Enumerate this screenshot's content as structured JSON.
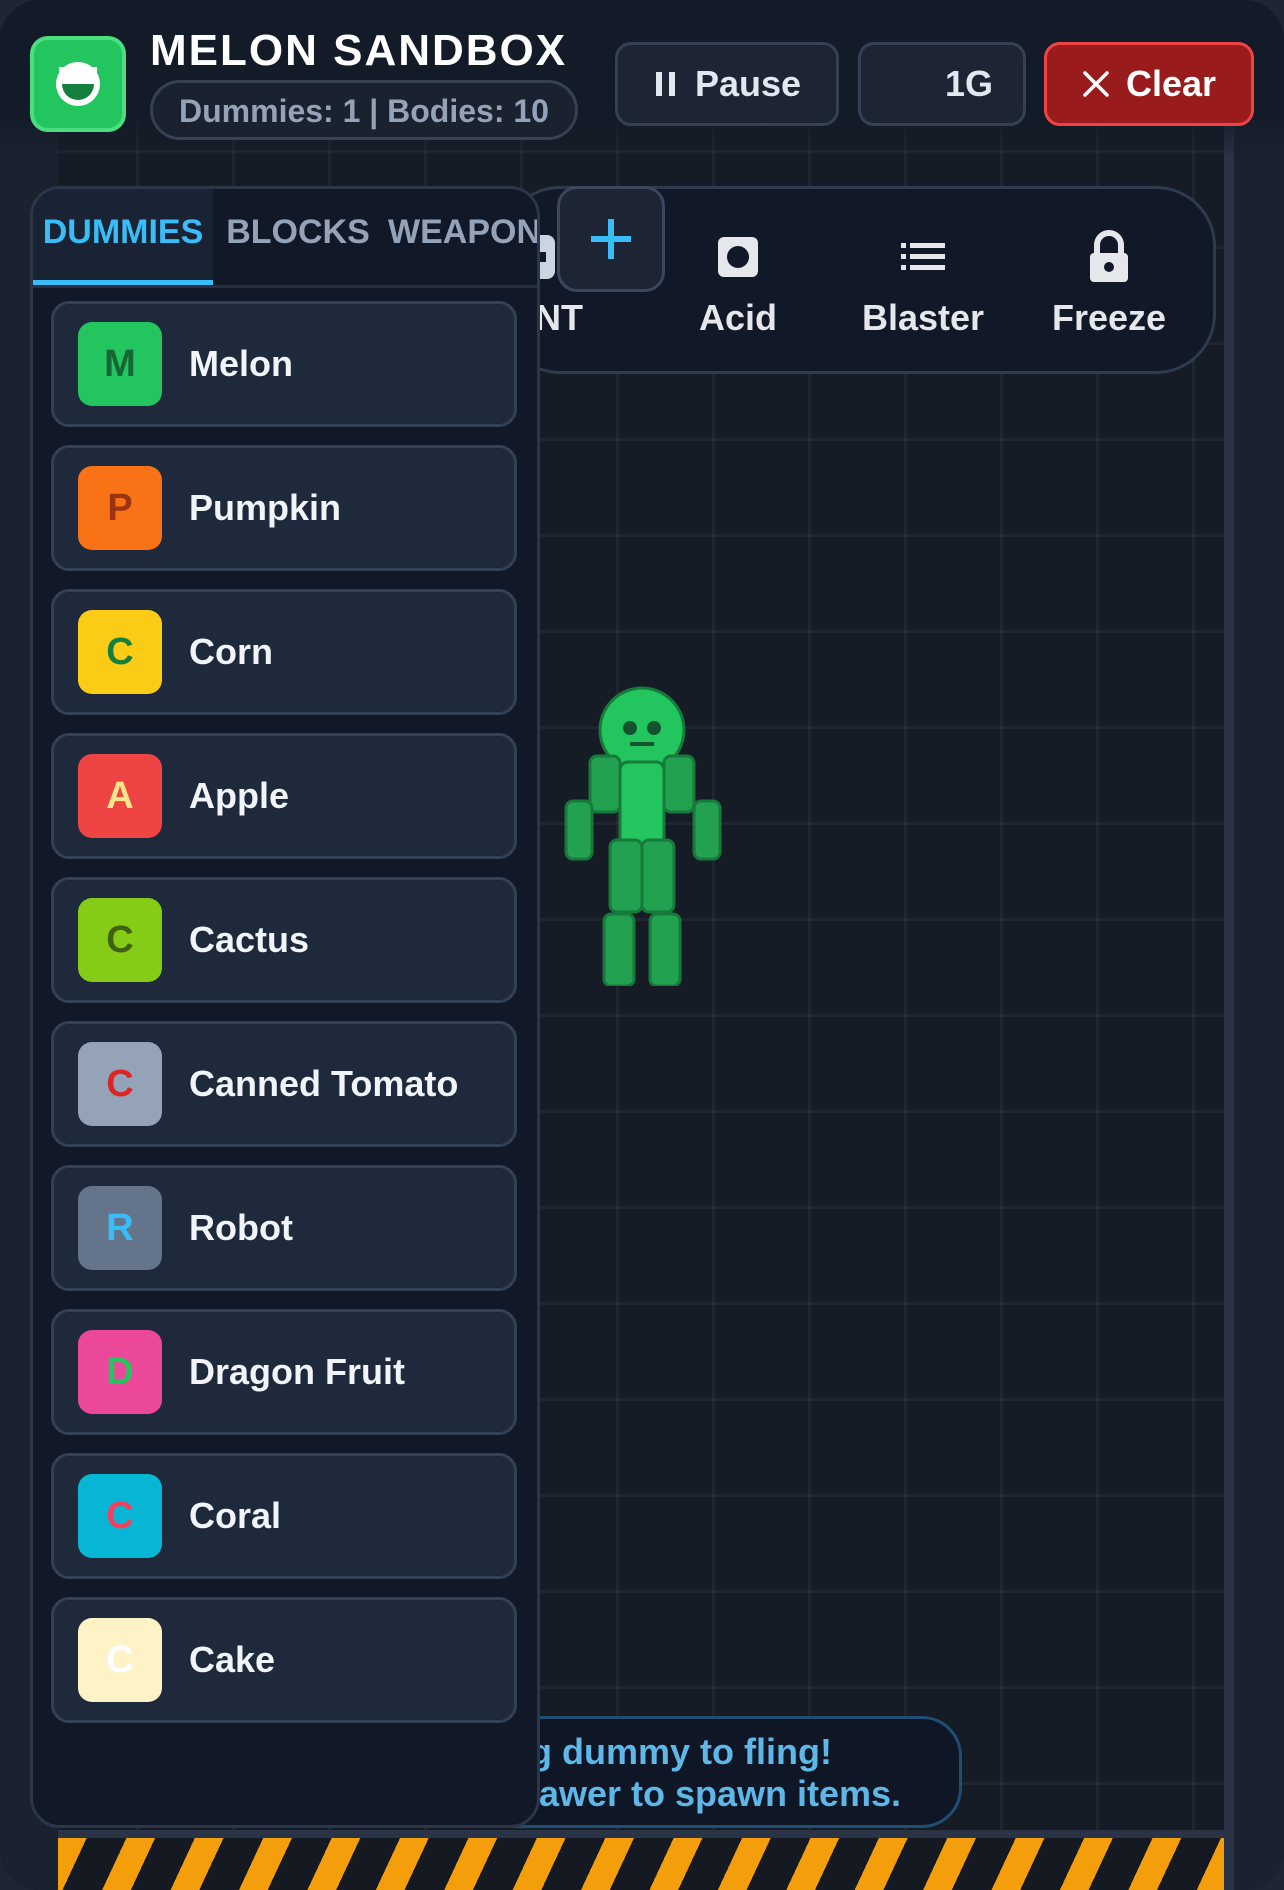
{
  "app": {
    "title": "MELON SANDBOX",
    "stats": "Dummies: 1 | Bodies: 10",
    "logo_icon": "melon-icon"
  },
  "controls": {
    "pause_label": "Pause",
    "pause_icon": "pause-icon",
    "gravity_label": "1G",
    "clear_label": "Clear",
    "clear_icon": "close-icon"
  },
  "tools": [
    {
      "label": "NT",
      "icon": "tnt-icon"
    },
    {
      "label": "Acid",
      "icon": "acid-icon"
    },
    {
      "label": "Blaster",
      "icon": "list-icon"
    },
    {
      "label": "Freeze",
      "icon": "lock-icon"
    }
  ],
  "drawer": {
    "tabs": [
      "DUMMIES",
      "BLOCKS",
      "WEAPON"
    ],
    "active_tab": "DUMMIES",
    "items": [
      {
        "letter": "M",
        "label": "Melon",
        "bg": "#22c55e",
        "fg": "#166534"
      },
      {
        "letter": "P",
        "label": "Pumpkin",
        "bg": "#f97316",
        "fg": "#9a3412"
      },
      {
        "letter": "C",
        "label": "Corn",
        "bg": "#facc15",
        "fg": "#15803d"
      },
      {
        "letter": "A",
        "label": "Apple",
        "bg": "#ef4444",
        "fg": "#fde68a"
      },
      {
        "letter": "C",
        "label": "Cactus",
        "bg": "#84cc16",
        "fg": "#3f6212"
      },
      {
        "letter": "C",
        "label": "Canned Tomato",
        "bg": "#94a3b8",
        "fg": "#dc2626"
      },
      {
        "letter": "R",
        "label": "Robot",
        "bg": "#64748b",
        "fg": "#38bdf8"
      },
      {
        "letter": "D",
        "label": "Dragon Fruit",
        "bg": "#ec4899",
        "fg": "#22c55e"
      },
      {
        "letter": "C",
        "label": "Coral",
        "bg": "#06b6d4",
        "fg": "#f43f5e"
      },
      {
        "letter": "C",
        "label": "Cake",
        "bg": "#fef3c7",
        "fg": "#ffffff"
      }
    ]
  },
  "hint": {
    "line1": "Drag dummy to fling!",
    "line2": "Open drawer to spawn items."
  },
  "colors": {
    "accent": "#38bdf8",
    "danger": "#991b1b",
    "dummy_green": "#22c55e"
  }
}
